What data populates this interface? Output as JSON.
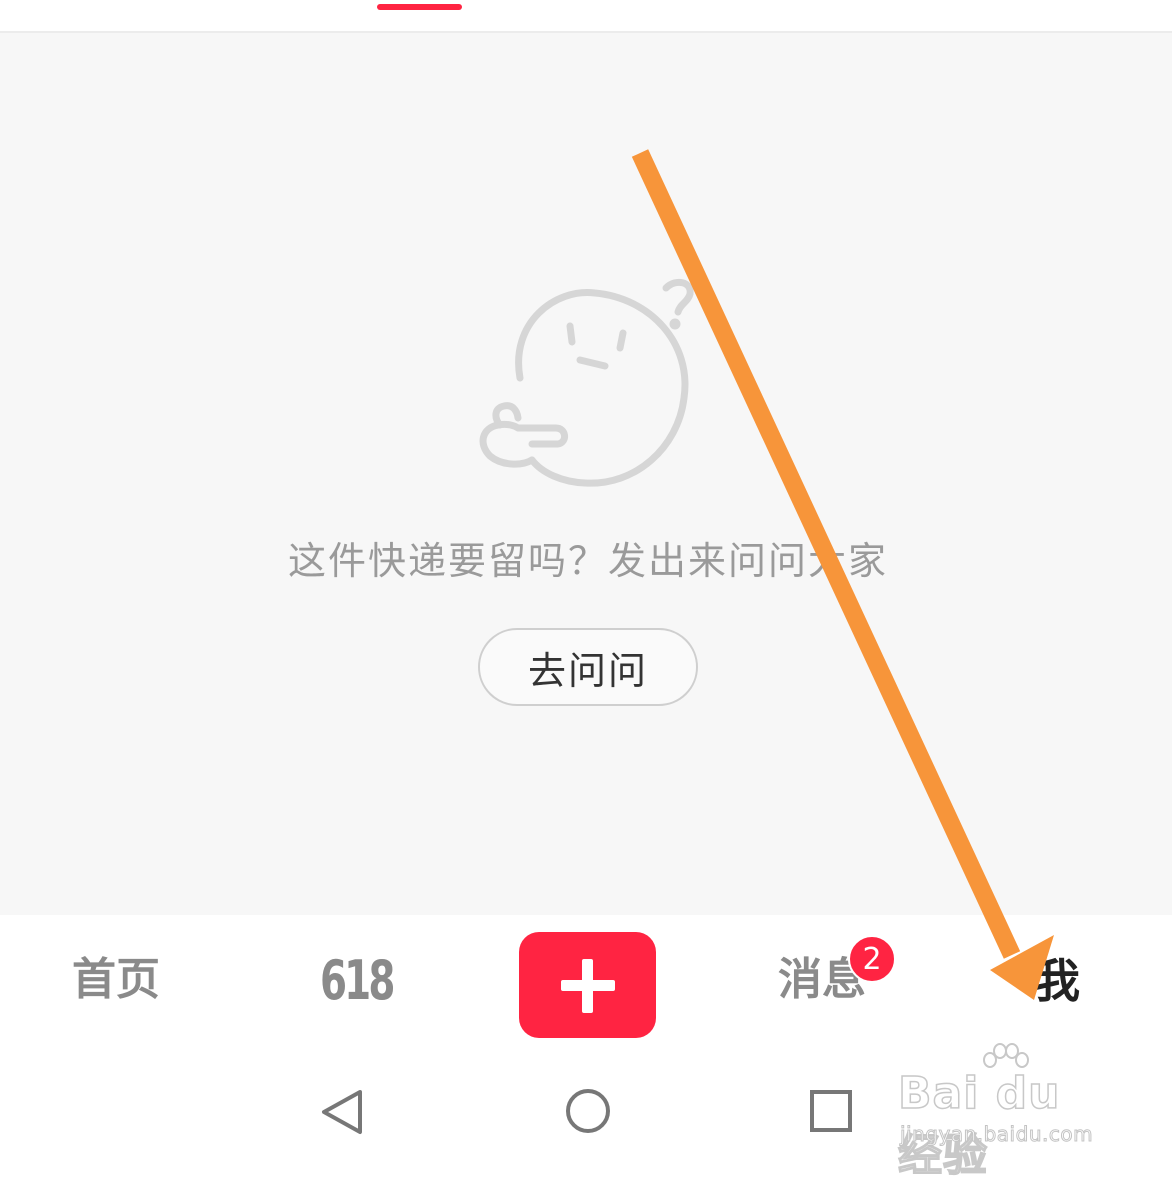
{
  "empty_state": {
    "message": "这件快递要留吗？发出来问问大家",
    "button_label": "去问问"
  },
  "bottom_nav": {
    "home": "首页",
    "promo": "618",
    "messages": "消息",
    "messages_badge": "2",
    "me": "我"
  },
  "system_nav": {
    "back_icon": "back-triangle-icon",
    "home_icon": "home-circle-icon",
    "recents_icon": "recents-square-icon"
  },
  "watermark": {
    "brand": "Bai du 经验",
    "url": "jingyan.baidu.com"
  },
  "colors": {
    "accent": "#ff2442",
    "arrow": "#f7953a",
    "background": "#f7f7f7"
  }
}
